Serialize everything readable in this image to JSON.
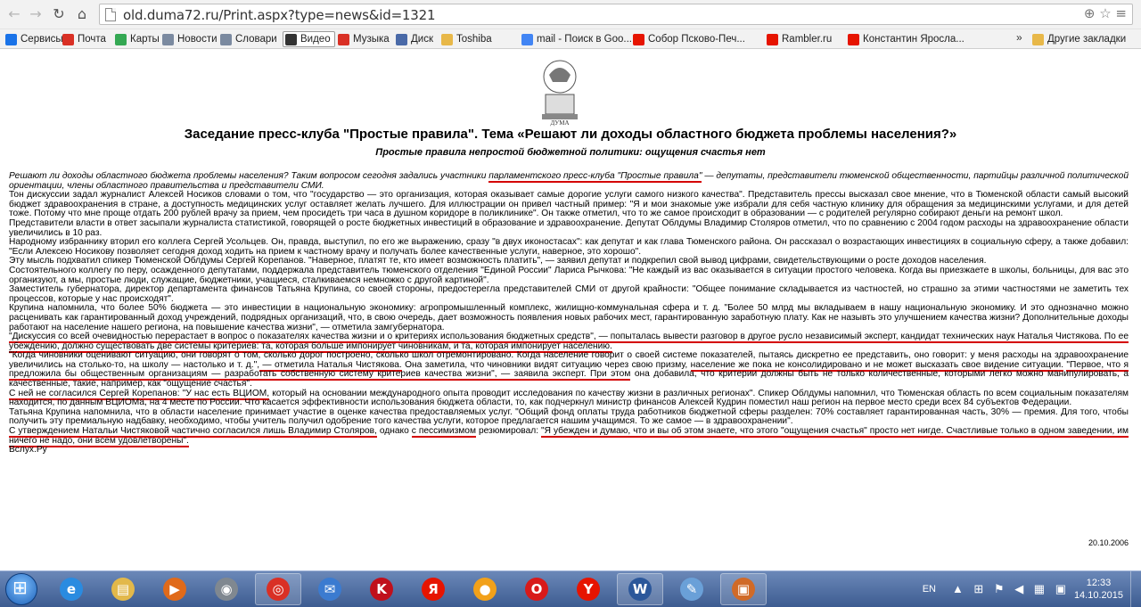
{
  "browser": {
    "url": "old.duma72.ru/Print.aspx?type=news&id=1321",
    "bookmarks": [
      {
        "label": "Сервисы",
        "icon": "apps-icon",
        "color": "#1a73e8"
      },
      {
        "label": "Почта",
        "icon": "mail-icon",
        "color": "#d93025"
      },
      {
        "label": "Карты",
        "icon": "maps-icon",
        "color": "#34a853"
      },
      {
        "label": "Новости",
        "icon": "page-icon",
        "color": "#7b8aa0"
      },
      {
        "label": "Словари",
        "icon": "page-icon",
        "color": "#7b8aa0"
      },
      {
        "label": "Видео",
        "icon": "video-icon",
        "color": "#333333"
      },
      {
        "label": "Музыка",
        "icon": "music-icon",
        "color": "#d93025"
      },
      {
        "label": "Диск",
        "icon": "disk-icon",
        "color": "#4a6aa8"
      },
      {
        "label": "Toshiba",
        "icon": "folder-icon",
        "color": "#e8b849"
      },
      {
        "label": "mail - Поиск в Goo...",
        "icon": "google-icon",
        "color": "#4285f4"
      },
      {
        "label": "Собор Псково-Печ...",
        "icon": "yandex-icon",
        "color": "#e61400"
      },
      {
        "label": "Rambler.ru",
        "icon": "yandex-icon",
        "color": "#e61400"
      },
      {
        "label": "Константин Яросла...",
        "icon": "yandex-icon",
        "color": "#e61400"
      }
    ],
    "more_label": "»",
    "other_bookmarks": "Другие закладки"
  },
  "article": {
    "emblem_text": "ДУМА",
    "title": "Заседание пресс-клуба \"Простые правила\". Тема «Решают ли доходы областного бюджета проблемы населения?»",
    "subtitle": "Простые правила непростой бюджетной политики: ощущения счастья нет",
    "lead_before": "Решают ли доходы областного бюджета проблемы населения? Таким вопросом сегодня задались участники ",
    "lead_link": "парламентского пресс-клуба \"Простые правила\"",
    "lead_after": " — депутаты, представители тюменской общественности, партийцы различной политической ориентации, члены областного правительства и представители СМИ.",
    "p1": "Тон дискуссии задал журналист Алексей Носиков словами о том, что \"государство — это организация, которая оказывает самые дорогие услуги самого низкого качества\". Представитель прессы высказал свое мнение, что в Тюменской области самый высокий бюджет здравоохранения в стране, а доступность медицинских услуг оставляет желать лучшего. Для иллюстрации он привел частный пример: \"Я и мои знакомые уже избрали для себя частную клинику для обращения за медицинскими услугами, и для детей тоже. Потому что мне проще отдать 200 рублей врачу за прием, чем просидеть три часа в душном коридоре в поликлинике\". Он также отметил, что то же самое происходит в образовании — с родителей регулярно собирают деньги на ремонт школ.",
    "p2": "Представители власти в ответ засыпали журналиста статистикой, говорящей о росте бюджетных инвестиций в образование и здравоохранение. Депутат Облдумы Владимир Столяров отметил, что по сравнению с 2004 годом расходы на здравоохранение области увеличились в 10 раз.",
    "p3": "Народному избраннику вторил его коллега Сергей Усольцев. Он, правда, выступил, по его же выражению, сразу \"в двух иконостасах\": как депутат и как глава Тюменского района. Он рассказал о возрастающих инвестициях в социальную сферу, а также добавил: \"Если Алексею Носикову позволяет сегодня доход ходить на прием к частному врачу и получать более качественные услуги, наверное, это хорошо\".",
    "p4": "Эту мысль подхватил спикер Тюменской Облдумы Сергей Корепанов. \"Наверное, платят те, кто имеет возможность платить\", — заявил депутат и подкрепил свой вывод цифрами, свидетельствующими о росте доходов населения.",
    "p5": "Состоятельного коллегу по перу, осажденного депутатами, поддержала представитель тюменского отделения \"Единой России\" Лариса Рычкова: \"Не каждый из вас оказывается в ситуации простого человека. Когда вы приезжаете в школы, больницы, для вас это организуют, а мы, простые люди, служащие, бюджетники, учащиеся, сталкиваемся немножко с другой картиной\".",
    "p6": "Заместитель губернатора, директор департамента финансов Татьяна Крупина, со своей стороны, предостерегла представителей СМИ от другой крайности: \"Общее понимание складывается из частностей, но страшно за этими частностями не заметить тех процессов, которые у нас происходят\".",
    "p7": "Крупина напомнила, что более 50% бюджета — это инвестиции в национальную экономику: агропромышленный комплекс, жилищно-коммунальная сфера и т. д. \"Более 50 млрд мы вкладываем в нашу национальную экономику. И это однозначно можно расценивать как гарантированный доход учреждений, подрядных организаций, что, в свою очередь, дает возможность появления новых рабочих мест, гарантированную заработную плату. Как не назывть это улучшением качества жизни? Дополнительные доходы работают на население нашего региона, на повышение качества жизни\", — отметила замгубернатора.",
    "p8": "\"Дискуссия со всей очевидностью перерастает в вопрос о показателях качества жизни и о критериях использования бюджетных средств\", — попыталась вывести разговор в другое русло независимый эксперт, кандидат технических наук Наталья Чистякова. По ее убеждению, должно существовать две системы критериев: та, которая больше импонирует чиновникам, и та, которая импонирует населению.",
    "p9a": "\"Когда чиновники оценивают ситуацию, они говорят о том, сколько дорог построено, сколько школ отремонтировано. Когда население говорит о своей системе показателей, пытаясь дискретно ее представить, оно говорит: у меня расходы на здравоохранение увеличились на столько-то, на школу — настолько и т. д.\",",
    "p9b": " — отметила Наталья Чистякова.",
    "p9c": " Она заметила, что чиновники видят ситуацию через свою призму, ",
    "p9d": "население же пока не консолидировано и не может высказать свое видение ситуации.",
    "p9e": " ",
    "p9f": "\"Первое, что я предложила бы общественным организациям — разработать собственную систему критериев качества жизни\", — заявила эксперт. При этом",
    "p9g": " она добавила, что критерии должны быть не только количественные, которыми легко можно манипулировать, а качественные, такие, например, как \"ощущение счастья\".",
    "p10a": "С ней не согласился Сергей Корепанов: \"У нас есть ВЦИОМ,",
    "p10b": " который на основании международного опыта проводит исследования по качеству жизни в различных регионах\". Спикер Облдумы напомнил, что Тюменская область по всем социальным показателям находится, по данным ВЦИОМа, на 4 месте по России. Что касается эффективности использования бюджета области, то, как подчеркнул министр финансов Алексей Кудрин поместил наш регион на первое место среди всех 84 субъектов Федерации.",
    "p11": "Татьяна Крупина напомнила, что в области население принимает участие в оценке качества предоставляемых услуг. \"Общий фонд оплаты труда работников бюджетной сферы разделен: 70% составляет гарантированная часть, 30% — премия. Для того, чтобы получить эту премиальную надбавку, необходимо, чтобы учитель получил одобрение того качества услуги, которое предлагается нашим учащимся. То же самое — в здравоохранении\".",
    "p12a": "С утверждением Натальи Чистяковой частично согласился лишь Владимир Столяров,",
    "p12b": " однако ",
    "p12c": "с пессимизмом",
    "p12d": " резюмировал: ",
    "p12e": "\"Я убежден и думаю, что и вы об этом знаете, что этого \"ощущения счастья\" просто нет нигде. Счастливые только в одном заведении, им ничего не надо, они всем удовлетворены\".",
    "source": "Вслух.Ру",
    "date": "20.10.2006"
  },
  "taskbar": {
    "apps": [
      {
        "name": "ie-icon",
        "glyph": "e",
        "color": "#2a8be0"
      },
      {
        "name": "explorer-icon",
        "glyph": "▤",
        "color": "#e2b84a"
      },
      {
        "name": "media-player-icon",
        "glyph": "▶",
        "color": "#e06a1a"
      },
      {
        "name": "disc-icon",
        "glyph": "◉",
        "color": "#808890"
      },
      {
        "name": "chrome-icon",
        "glyph": "◎",
        "color": "#d93025"
      },
      {
        "name": "email-icon",
        "glyph": "✉",
        "color": "#3b7bd0"
      },
      {
        "name": "kaspersky-icon",
        "glyph": "K",
        "color": "#c0101c"
      },
      {
        "name": "yandex-icon",
        "glyph": "Я",
        "color": "#e61400"
      },
      {
        "name": "agent-icon",
        "glyph": "●",
        "color": "#f2a11a"
      },
      {
        "name": "opera-icon",
        "glyph": "O",
        "color": "#d81a1a"
      },
      {
        "name": "yandex-browser-icon",
        "glyph": "Y",
        "color": "#e61400"
      },
      {
        "name": "word-icon",
        "glyph": "W",
        "color": "#2b579a"
      },
      {
        "name": "paint-icon",
        "glyph": "✎",
        "color": "#6aa0d8"
      },
      {
        "name": "app-icon",
        "glyph": "▣",
        "color": "#d06a28"
      }
    ],
    "lang": "EN",
    "time": "12:33",
    "date": "14.10.2015"
  }
}
